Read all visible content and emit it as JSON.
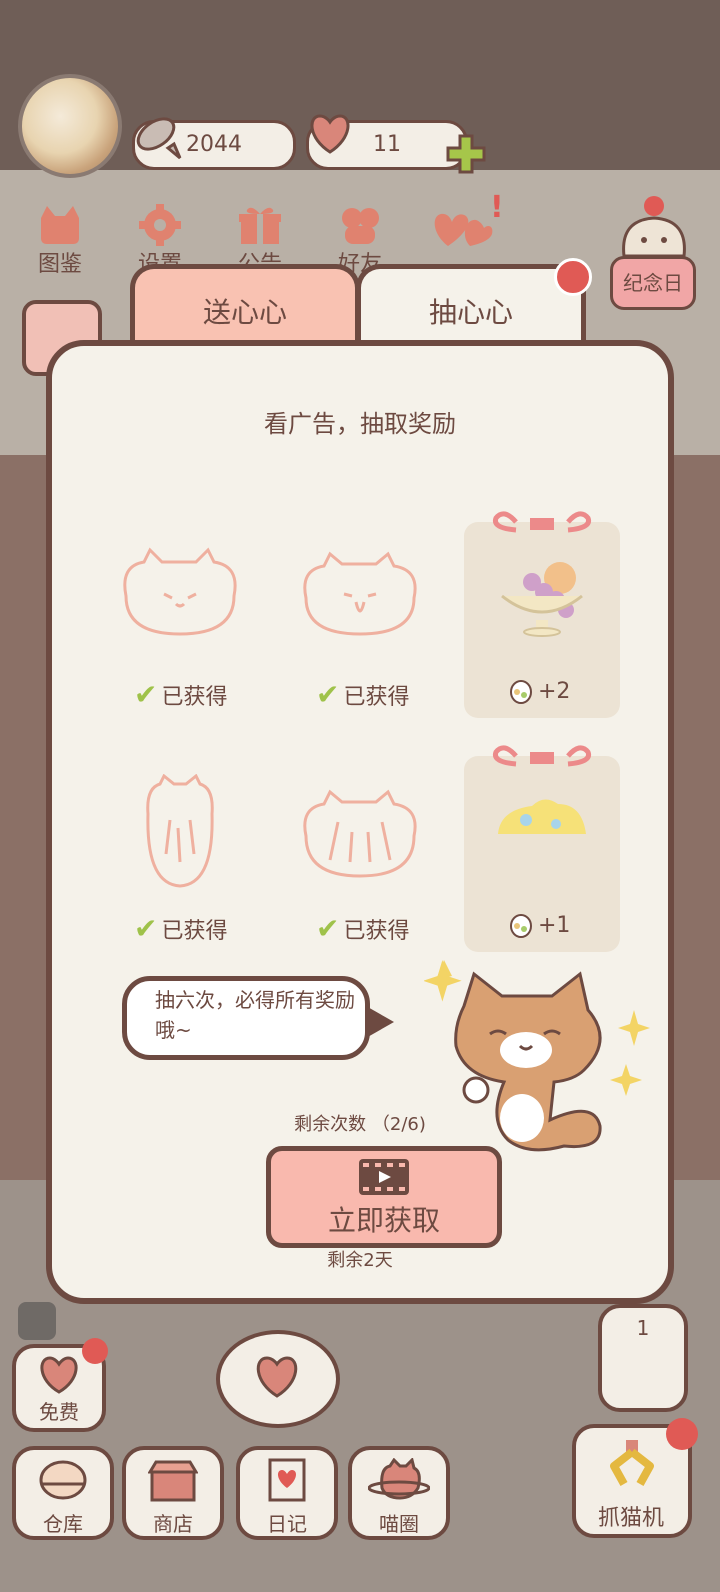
{
  "header": {
    "fish_count": "2044",
    "heart_count": "11"
  },
  "top_nav": [
    {
      "label": "图鉴",
      "icon": "cat-book-icon"
    },
    {
      "label": "设置",
      "icon": "gear-icon"
    },
    {
      "label": "公告",
      "icon": "gift-icon"
    },
    {
      "label": "好友",
      "icon": "friends-icon"
    }
  ],
  "anniversary_label": "纪念日",
  "tabs": {
    "send": "送心心",
    "draw": "抽心心"
  },
  "modal": {
    "subtitle": "看广告，抽取奖励",
    "obtained_label": "已获得",
    "reward1": "+2",
    "reward2": "+1",
    "speech": "抽六次，必得所有奖励哦~",
    "remaining_count": "剩余次数 （2/6)",
    "action_button": "立即获取",
    "remaining_days": "剩余2天"
  },
  "bottom": {
    "free": "免费",
    "storage": "仓库",
    "shop": "商店",
    "diary": "日记",
    "circle": "喵圈",
    "claw": "抓猫机",
    "claw_count": "1"
  },
  "colors": {
    "brown": "#6d4a41",
    "pink": "#f9c2b2",
    "cream": "#f5f2ea",
    "green_check": "#9fc24a",
    "red_dot": "#e05a55"
  }
}
